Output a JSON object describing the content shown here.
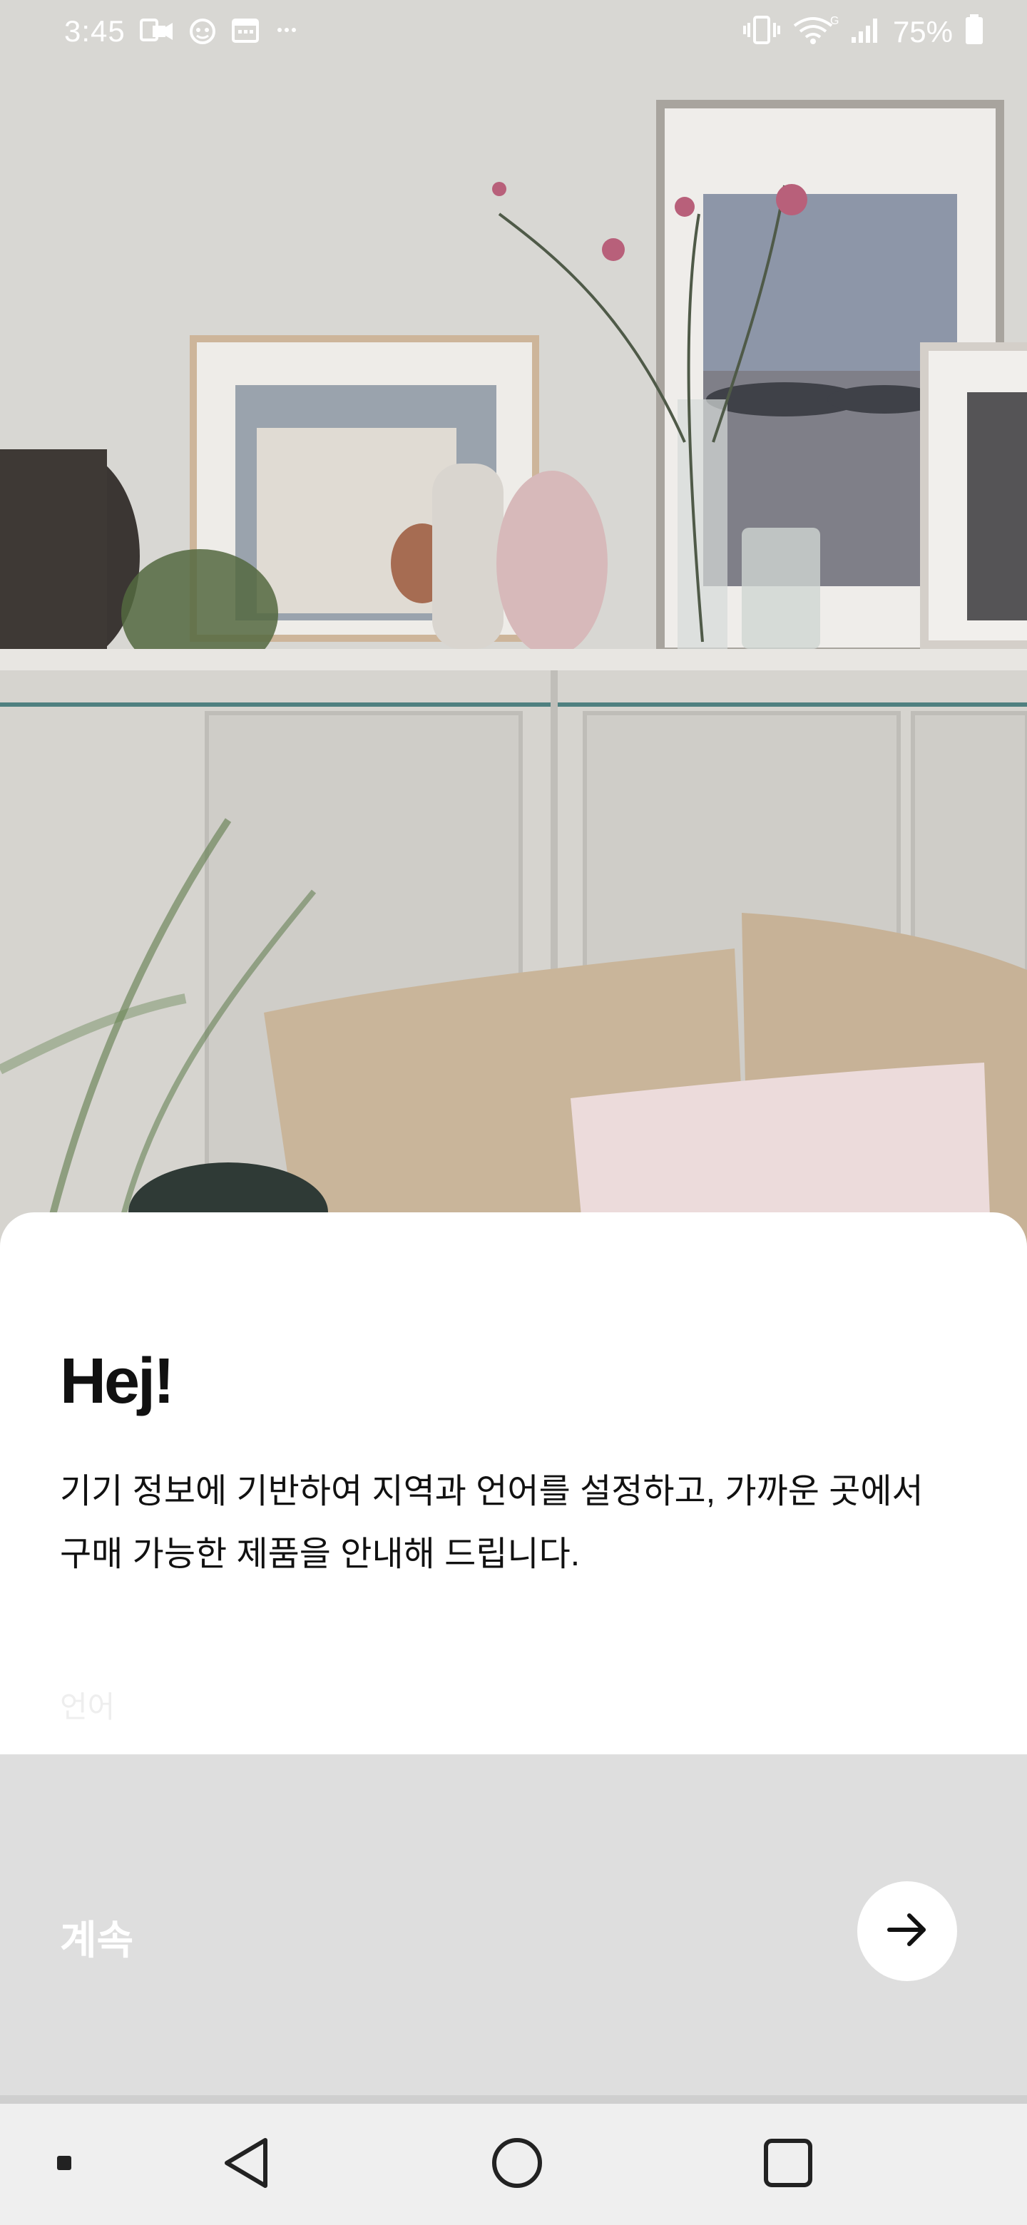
{
  "status_bar": {
    "time": "3:45",
    "battery_percent": "75%",
    "left_icons": [
      "screen-record-icon",
      "bixby-icon",
      "calendar-icon",
      "more-dots-icon"
    ],
    "right_icons": [
      "vibrate-icon",
      "wifi-calling-icon",
      "signal-icon",
      "battery-icon"
    ]
  },
  "background": {
    "description_icon": "living-room-photo"
  },
  "sheet": {
    "greeting": "Hej!",
    "description": "기기 정보에 기반하여 지역과 언어를 설정하고, 가까운 곳에서 구매 가능한 제품을 안내해 드립니다.",
    "language_label": "언어"
  },
  "continue": {
    "label": "계속",
    "button_icon": "arrow-right-icon",
    "bar_color": "#dedede"
  },
  "nav_bar": {
    "items": [
      "dot-icon",
      "back-icon",
      "home-icon",
      "recents-icon"
    ]
  }
}
